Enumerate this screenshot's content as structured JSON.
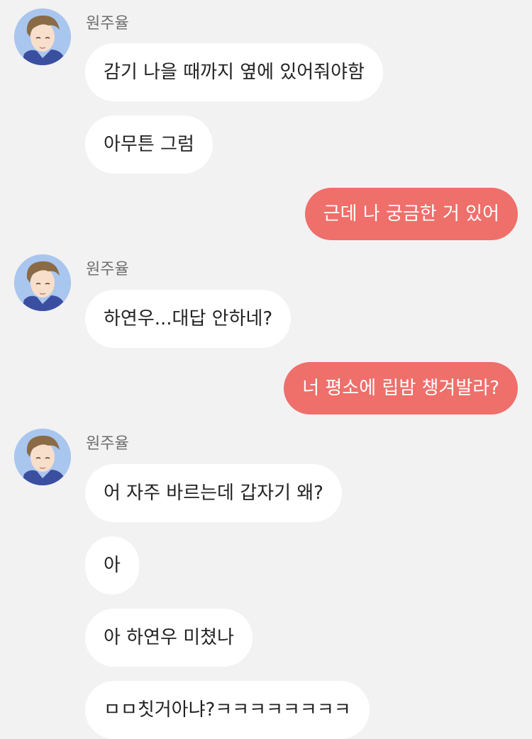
{
  "colors": {
    "background": "#f2f2f2",
    "incoming_bubble": "#ffffff",
    "outgoing_bubble": "#ef6f6b",
    "sender_name": "#6e6e6e"
  },
  "contact": {
    "name": "원주율",
    "avatar_icon": "avatar-icon"
  },
  "messages": {
    "m1": "감기 나을 때까지 옆에 있어줘야함",
    "m2": "아무튼 그럼",
    "m3": "근데 나 궁금한 거 있어",
    "m4": "하연우...대답 안하네?",
    "m5": "너 평소에 립밤 챙겨발라?",
    "m6": "어 자주 바르는데 갑자기 왜?",
    "m7": "아",
    "m8": "아 하연우 미쳤나",
    "m9": "ㅁㅁ칫거아냐?ㅋㅋㅋㅋㅋㅋㅋㅋ"
  }
}
